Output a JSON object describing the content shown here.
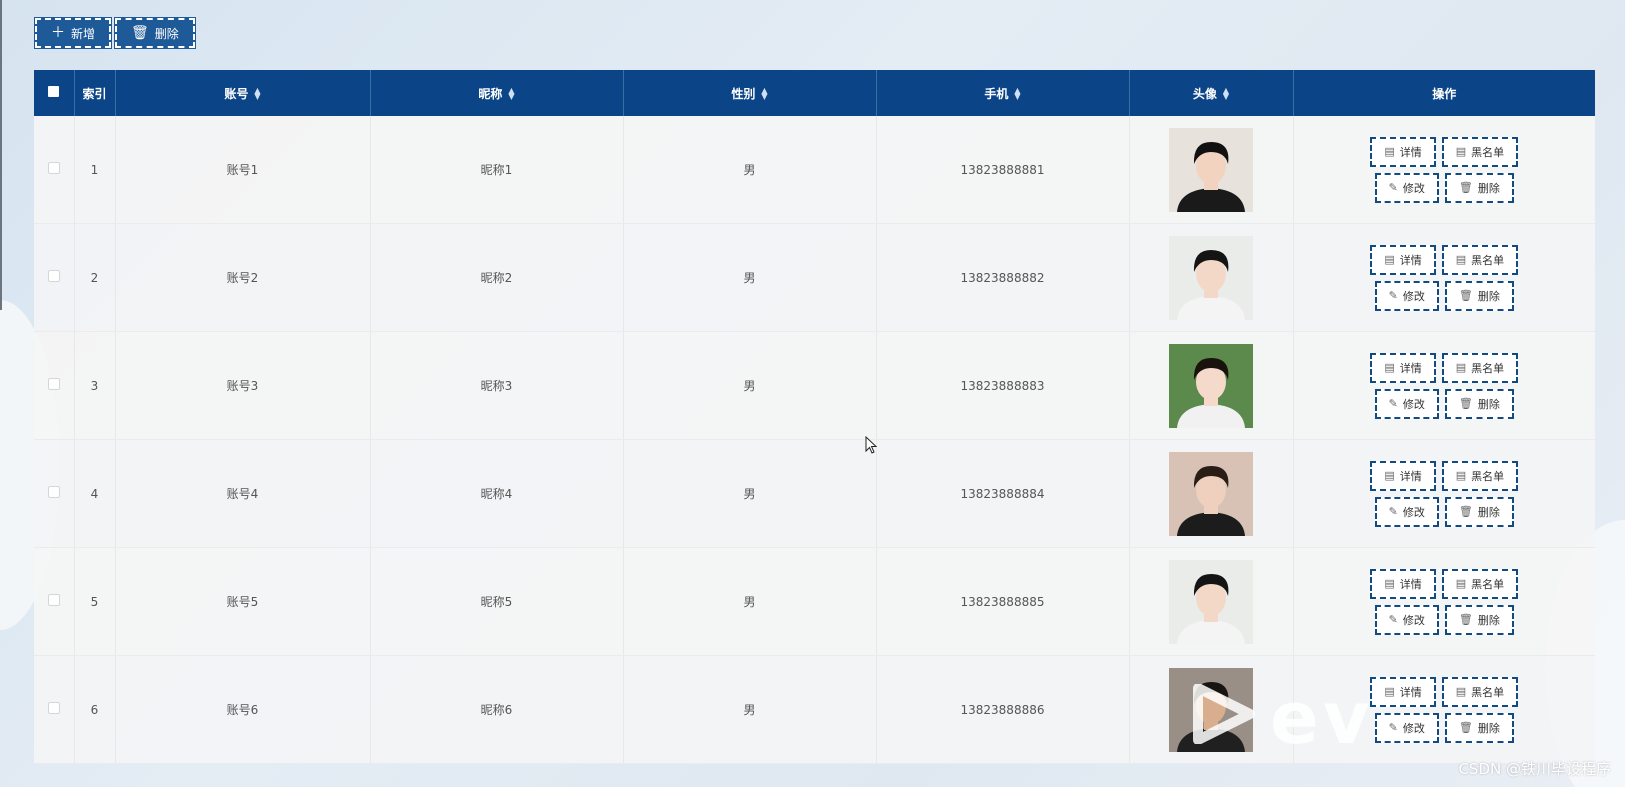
{
  "toolbar": {
    "add_label": "新增",
    "delete_label": "删除"
  },
  "table": {
    "headers": {
      "index": "索引",
      "account": "账号",
      "nickname": "昵称",
      "gender": "性别",
      "phone": "手机",
      "avatar": "头像",
      "actions": "操作"
    },
    "actions": {
      "detail": "详情",
      "blacklist": "黑名单",
      "edit": "修改",
      "delete": "删除"
    },
    "rows": [
      {
        "index": "1",
        "account": "账号1",
        "nickname": "昵称1",
        "gender": "男",
        "phone": "13823888881"
      },
      {
        "index": "2",
        "account": "账号2",
        "nickname": "昵称2",
        "gender": "男",
        "phone": "13823888882"
      },
      {
        "index": "3",
        "account": "账号3",
        "nickname": "昵称3",
        "gender": "男",
        "phone": "13823888883"
      },
      {
        "index": "4",
        "account": "账号4",
        "nickname": "昵称4",
        "gender": "男",
        "phone": "13823888884"
      },
      {
        "index": "5",
        "account": "账号5",
        "nickname": "昵称5",
        "gender": "男",
        "phone": "13823888885"
      },
      {
        "index": "6",
        "account": "账号6",
        "nickname": "昵称6",
        "gender": "男",
        "phone": "13823888886"
      }
    ]
  },
  "watermark": "CSDN @铁川毕设程序",
  "overlay_logo": "ev",
  "colors": {
    "header_bg": "#0b4588",
    "button_bg": "#1f5a98",
    "op_border": "#134a82"
  }
}
